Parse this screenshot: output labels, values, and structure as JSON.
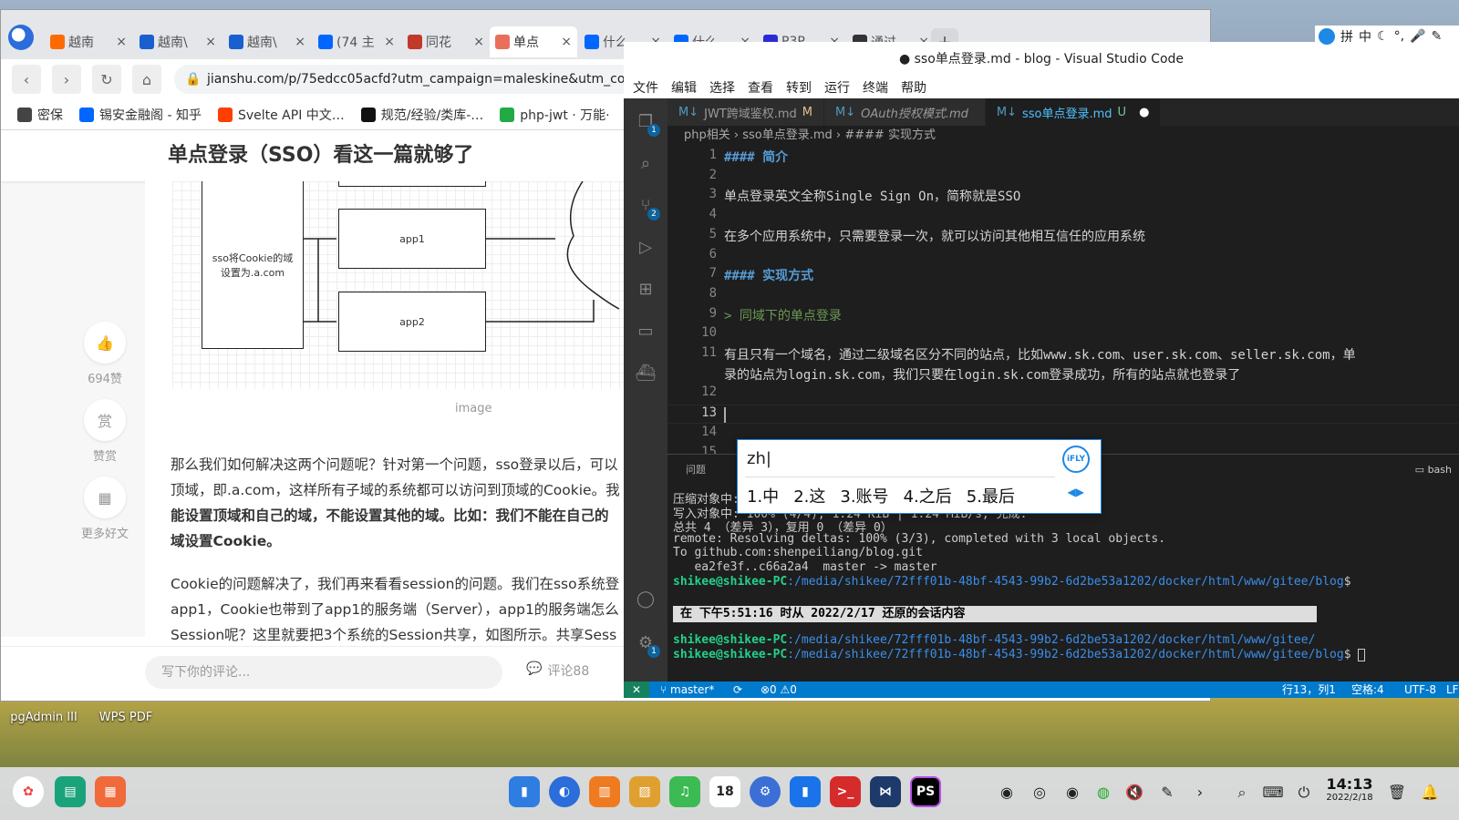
{
  "browser": {
    "tabs": [
      {
        "label": "越南",
        "favicon": "bolt-icon",
        "color": "#ff6a00"
      },
      {
        "label": "越南\\",
        "favicon": "wikipedia-icon",
        "color": "#1a5fd0"
      },
      {
        "label": "越南\\",
        "favicon": "wikipedia-icon",
        "color": "#1a5fd0"
      },
      {
        "label": "(74 主",
        "favicon": "zhihu-icon",
        "color": "#0066ff"
      },
      {
        "label": "同花",
        "favicon": "book-icon",
        "color": "#c0392b"
      },
      {
        "label": "单点",
        "favicon": "jianshu-icon",
        "color": "#ea6f5a",
        "active": true
      },
      {
        "label": "什么",
        "favicon": "zhihu-icon",
        "color": "#0066ff"
      },
      {
        "label": "什么",
        "favicon": "zhihu-icon",
        "color": "#0066ff"
      },
      {
        "label": "P3P",
        "favicon": "paw-icon",
        "color": "#2b2bd6"
      },
      {
        "label": "通过",
        "favicon": "git-icon",
        "color": "#333333"
      }
    ],
    "new_tab": "+",
    "url": "jianshu.com/p/75edcc05acfd?utm_campaign=maleskine&utm_content",
    "bookmarks": [
      {
        "label": "密保",
        "icon": "gear-icon",
        "color": "#444444"
      },
      {
        "label": "锡安金融阁 - 知乎",
        "icon": "zhihu-icon",
        "color": "#0066ff"
      },
      {
        "label": "Svelte API 中文…",
        "icon": "svelte-icon",
        "color": "#ff3e00"
      },
      {
        "label": "规范/经验/类库-…",
        "icon": "github-icon",
        "color": "#111111"
      },
      {
        "label": "php-jwt · 万能·",
        "icon": "cloud-icon",
        "color": "#22aa44"
      }
    ],
    "article": {
      "title": "单点登录（SSO）看这一篇就够了",
      "diagram": {
        "box_left": "sso将Cookie的域设置为.a.com",
        "box_app1": "app1",
        "box_app2": "app2"
      },
      "caption": "image",
      "para1_a": "那么我们如何解决这两个问题呢？针对第一个问题，sso登录以后，可以",
      "para1_b": "顶域，即.a.com，这样所有子域的系统都可以访问到顶域的Cookie。我",
      "para1_c": "能设置顶域和自己的域，不能设置其他的域。比如：我们不能在自己的",
      "para1_d": "域设置Cookie。",
      "para2_a": "Cookie的问题解决了，我们再来看看session的问题。我们在sso系统登",
      "para2_b": "app1，Cookie也带到了app1的服务端（Server），app1的服务端怎么",
      "para2_c": "Session呢？这里就要把3个系统的Session共享，如图所示。共享Sess"
    },
    "side": {
      "likes": "694赞",
      "reward_icon_text": "赏",
      "reward": "赞赏",
      "more": "更多好文"
    },
    "comment_placeholder": "写下你的评论...",
    "comment_count": "评论88"
  },
  "vscode": {
    "title": "● sso单点登录.md - blog - Visual Studio Code",
    "menu": [
      "文件",
      "编辑",
      "选择",
      "查看",
      "转到",
      "运行",
      "终端",
      "帮助"
    ],
    "tabs": [
      {
        "label": "JWT跨域鉴权.md",
        "status": "M"
      },
      {
        "label": "OAuth授权模式.md",
        "status": ""
      },
      {
        "label": "sso单点登录.md",
        "status": "U"
      }
    ],
    "tab_icon": "M↓",
    "dirty_dot": "●",
    "breadcrumb": [
      "php相关",
      "sso单点登录.md",
      "#### 实现方式"
    ],
    "lines": [
      {
        "n": "1",
        "text": "#### 简介",
        "kind": "hdr"
      },
      {
        "n": "2",
        "text": "",
        "kind": ""
      },
      {
        "n": "3",
        "text": "单点登录英文全称Single Sign On，简称就是SSO",
        "kind": ""
      },
      {
        "n": "4",
        "text": "",
        "kind": ""
      },
      {
        "n": "5",
        "text": "在多个应用系统中，只需要登录一次，就可以访问其他相互信任的应用系统",
        "kind": ""
      },
      {
        "n": "6",
        "text": "",
        "kind": ""
      },
      {
        "n": "7",
        "text": "#### 实现方式",
        "kind": "hdr"
      },
      {
        "n": "8",
        "text": "",
        "kind": ""
      },
      {
        "n": "9",
        "text": "> 同域下的单点登录",
        "kind": "quote"
      },
      {
        "n": "10",
        "text": "",
        "kind": ""
      },
      {
        "n": "11",
        "text": "有且只有一个域名，通过二级域名区分不同的站点，比如www.sk.com、user.sk.com、seller.sk.com，单",
        "kind": ""
      },
      {
        "n": "",
        "text": "录的站点为login.sk.com，我们只要在login.sk.com登录成功，所有的站点就也登录了",
        "kind": ""
      },
      {
        "n": "12",
        "text": "",
        "kind": ""
      },
      {
        "n": "13",
        "text": "",
        "kind": ""
      },
      {
        "n": "14",
        "text": "",
        "kind": ""
      },
      {
        "n": "15",
        "text": "",
        "kind": ""
      }
    ],
    "panel_tab": "问题",
    "panel_shell": "bash",
    "terminal": [
      "压缩对象中: 100% (3/3), 完成.",
      "写入对象中: 100% (4/4), 1.24 KiB | 1.24 MiB/s, 完成.",
      "总共 4 （差异 3），复用 0 （差异 0）",
      "remote: Resolving deltas: 100% (3/3), completed with 3 local objects.",
      "To github.com:shenpeiliang/blog.git",
      "   ea2fe3f..c66a2a4  master -> master"
    ],
    "prompt_user": "shikee@shikee-PC",
    "prompt_path": ":/media/shikee/72fff01b-48bf-4543-99b2-6d2be53a1202/docker/html/www/gitee/blog",
    "prompt_path2": ":/media/shikee/72fff01b-48bf-4543-99b2-6d2be53a1202/docker/html/www/gitee/",
    "prompt_end": "$",
    "restore_msg": "在 下午5:51:16 时从 2022/2/17 还原的会话内容",
    "status": {
      "branch": "master*",
      "problems": "⊗0 ⚠0",
      "position": "行13，列1",
      "spaces": "空格:4",
      "encoding": "UTF-8",
      "eol": "LF"
    }
  },
  "ime": {
    "input": "zh|",
    "logo": "iFLY",
    "candidates": [
      "1.中",
      "2.这",
      "3.账号",
      "4.之后",
      "5.最后"
    ]
  },
  "tray": {
    "pinyin": "拼",
    "zh": "中"
  },
  "desktop": {
    "icons": [
      {
        "label": "pgAdmin III"
      },
      {
        "label": "WPS PDF"
      }
    ]
  },
  "taskbar": {
    "time": "14:13",
    "date": "2022/2/18",
    "calendar_day": "18",
    "colors": {
      "accent": "#007acc",
      "jianshu": "#ea6f5a"
    }
  }
}
